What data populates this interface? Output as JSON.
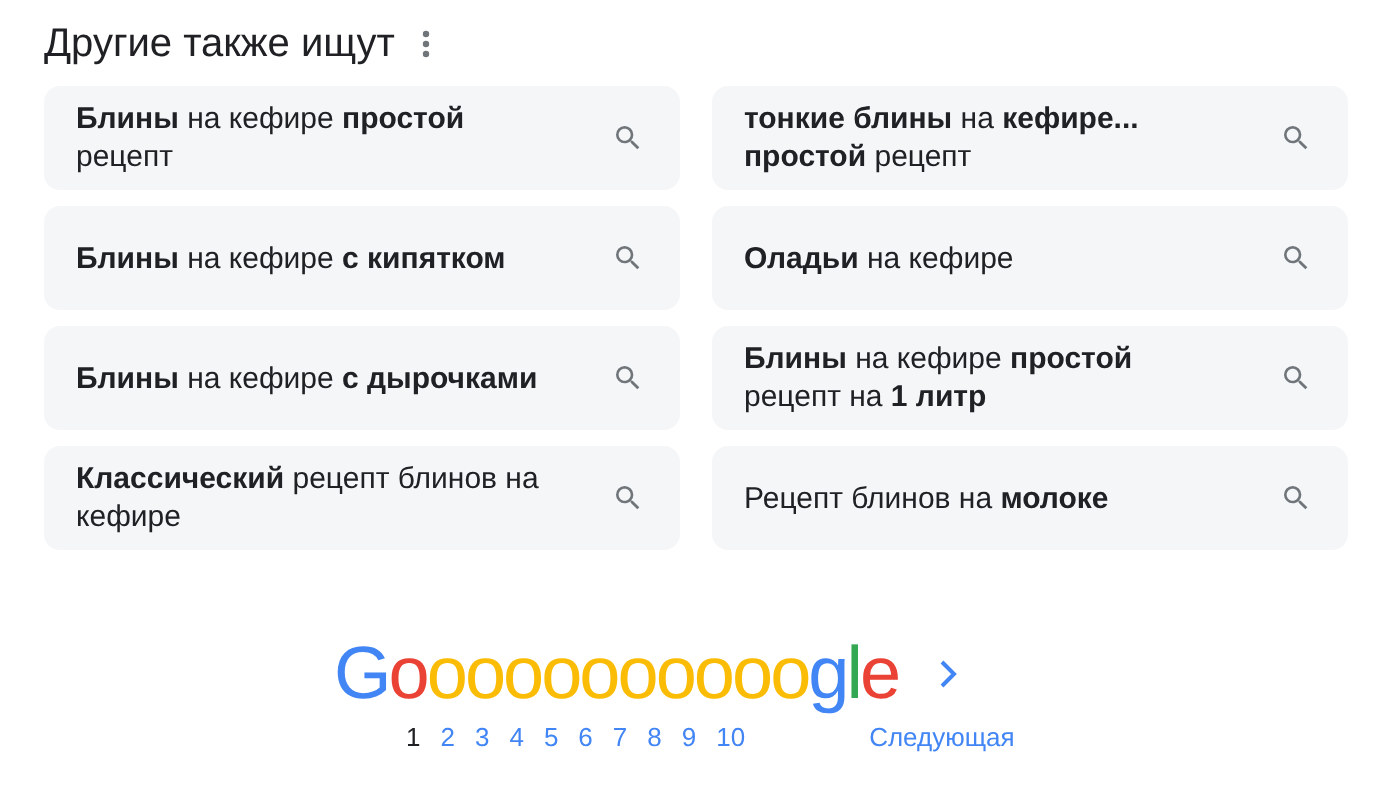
{
  "title": "Другие также ищут",
  "suggestions": [
    {
      "text": "**Блины** на кефире **простой** рецепт"
    },
    {
      "text": "**Блины** на кефире **с кипятком**"
    },
    {
      "text": "**Блины** на кефире **с дырочками**"
    },
    {
      "text": "**Классический** рецепт блинов на кефире"
    },
    {
      "text": "**тонкие блины** на **кефире... простой** рецепт"
    },
    {
      "text": "**Оладьи** на кефире"
    },
    {
      "text": "**Блины** на кефире **простой** рецепт на **1 литр**"
    },
    {
      "text": "Рецепт блинов на **молоке**"
    }
  ],
  "pagination": {
    "logo": [
      {
        "letter": "G",
        "color": "#4285f4"
      },
      {
        "letter": "o",
        "color": "#ea4335"
      },
      {
        "letter": "o",
        "color": "#fbbc05"
      },
      {
        "letter": "o",
        "color": "#fbbc05"
      },
      {
        "letter": "o",
        "color": "#fbbc05"
      },
      {
        "letter": "o",
        "color": "#fbbc05"
      },
      {
        "letter": "o",
        "color": "#fbbc05"
      },
      {
        "letter": "o",
        "color": "#fbbc05"
      },
      {
        "letter": "o",
        "color": "#fbbc05"
      },
      {
        "letter": "o",
        "color": "#fbbc05"
      },
      {
        "letter": "o",
        "color": "#fbbc05"
      },
      {
        "letter": "o",
        "color": "#fbbc05"
      },
      {
        "letter": "g",
        "color": "#4285f4"
      },
      {
        "letter": "l",
        "color": "#34a853"
      },
      {
        "letter": "e",
        "color": "#ea4335"
      }
    ],
    "pages": [
      {
        "label": "1",
        "selected": true
      },
      {
        "label": "2",
        "selected": false
      },
      {
        "label": "3",
        "selected": false
      },
      {
        "label": "4",
        "selected": false
      },
      {
        "label": "5",
        "selected": false
      },
      {
        "label": "6",
        "selected": false
      },
      {
        "label": "7",
        "selected": false
      },
      {
        "label": "8",
        "selected": false
      },
      {
        "label": "9",
        "selected": false
      },
      {
        "label": "10",
        "selected": false
      }
    ],
    "next": "Следующая"
  }
}
